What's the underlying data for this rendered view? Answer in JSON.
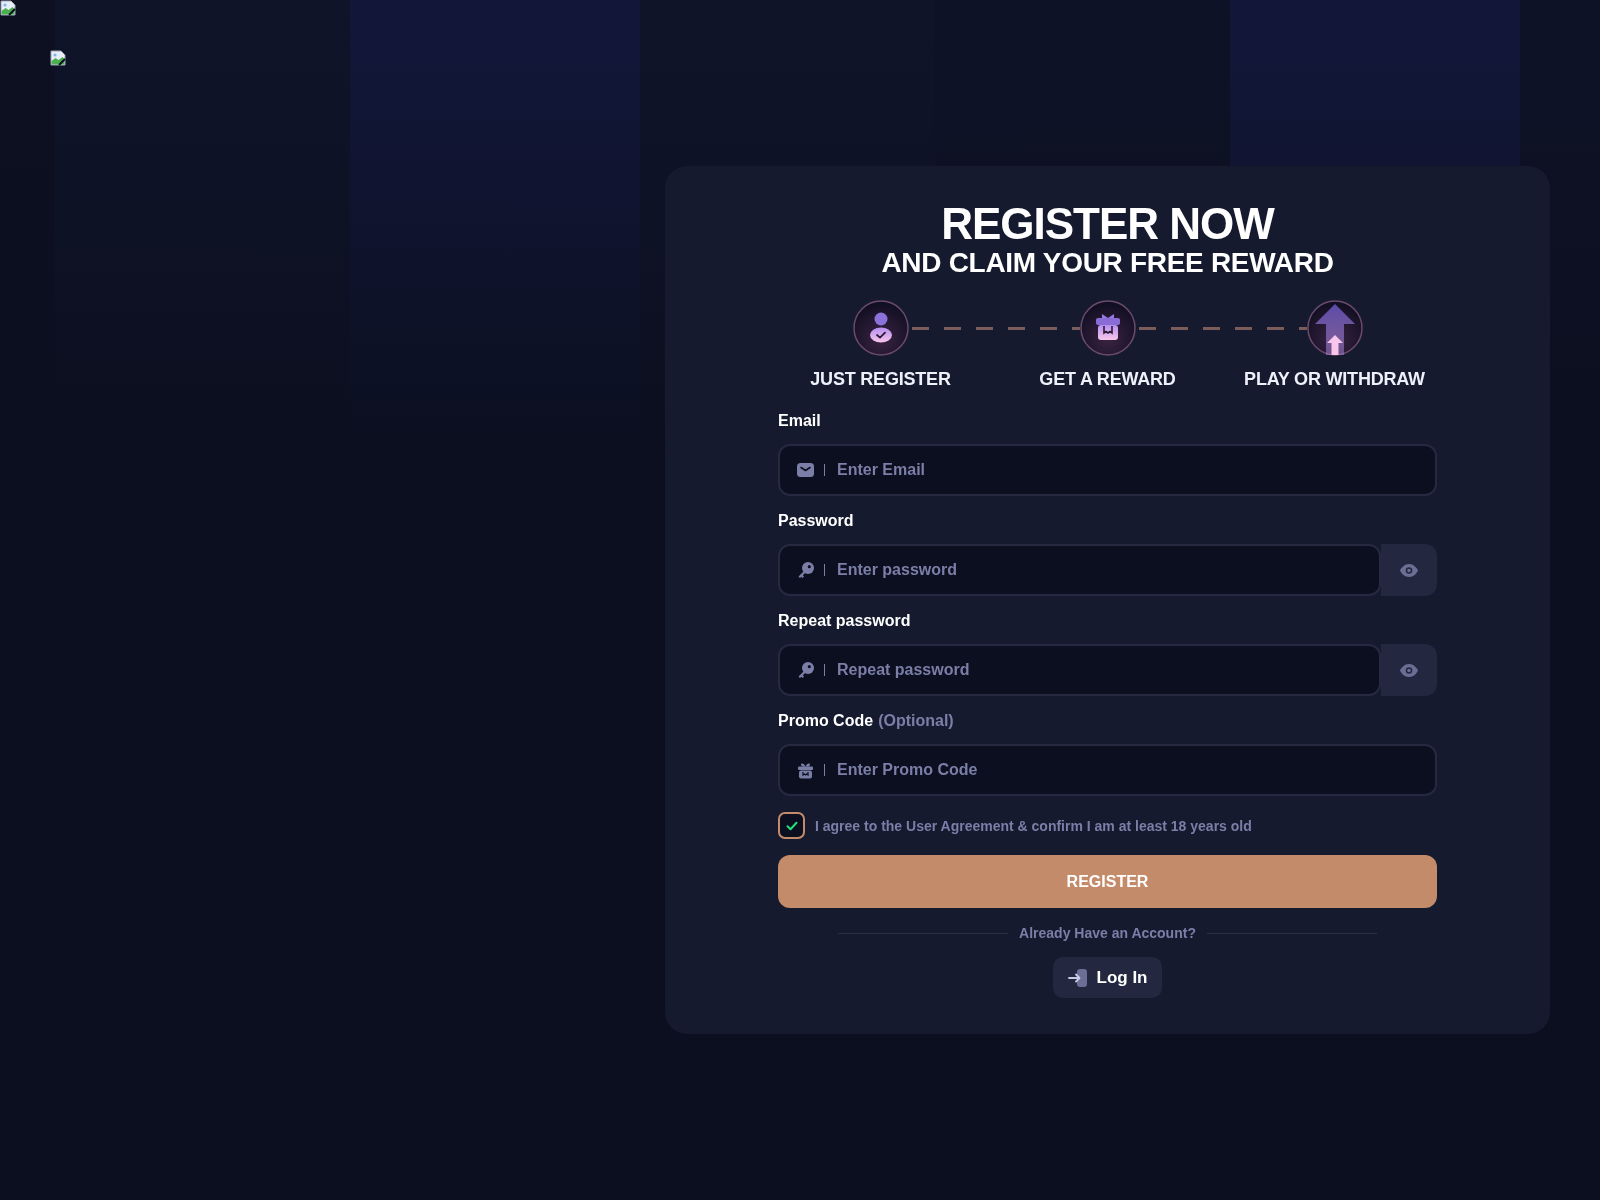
{
  "card": {
    "title": "REGISTER NOW",
    "subtitle": "AND CLAIM YOUR FREE REWARD"
  },
  "steps": [
    {
      "kind": "register",
      "label": "JUST REGISTER"
    },
    {
      "kind": "reward",
      "label": "GET A REWARD"
    },
    {
      "kind": "withdraw",
      "label": "PLAY OR WITHDRAW"
    }
  ],
  "form": {
    "fields": [
      {
        "kind": "email",
        "label": "Email",
        "placeholder": "Enter Email"
      },
      {
        "kind": "password",
        "label": "Password",
        "placeholder": "Enter password"
      },
      {
        "kind": "password",
        "label": "Repeat password",
        "placeholder": "Repeat password"
      },
      {
        "kind": "promo",
        "label": "Promo Code",
        "note": "(Optional)",
        "placeholder": "Enter Promo Code"
      }
    ],
    "agreement": {
      "text": "I agree to the User Agreement & confirm I am at least 18 years old",
      "checked": true
    },
    "submit": "REGISTER",
    "login_prompt": "Already Have an Account?",
    "login_button": "Log In"
  }
}
